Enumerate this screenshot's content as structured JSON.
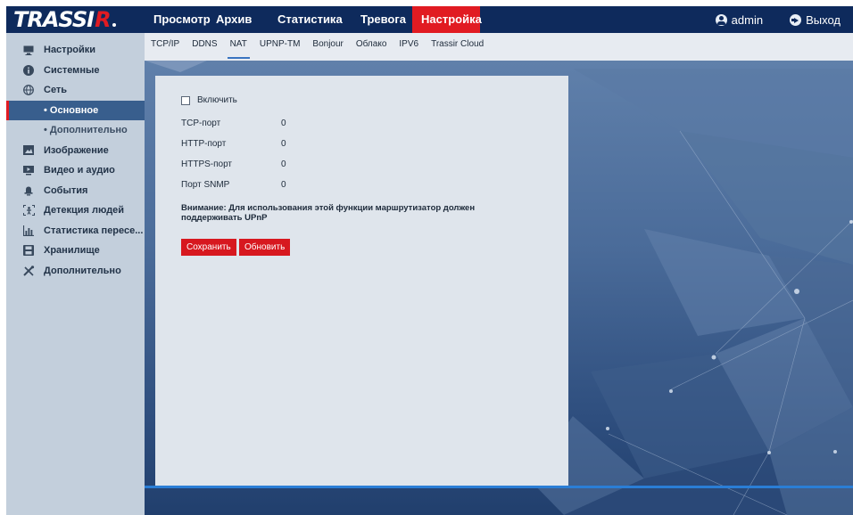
{
  "brand": {
    "logo_main": "TRASSI",
    "logo_accent": "R"
  },
  "top_nav": [
    {
      "label": "Просмотр",
      "active": false
    },
    {
      "label": "Архив",
      "active": false
    },
    {
      "label": "Статистика",
      "active": false
    },
    {
      "label": "Тревога",
      "active": false
    },
    {
      "label": "Настройка",
      "active": true
    }
  ],
  "user": {
    "name": "admin",
    "logout_label": "Выход"
  },
  "sidebar": [
    {
      "label": "Настройки",
      "icon": "monitor-icon",
      "level": 0
    },
    {
      "label": "Системные",
      "icon": "info-icon",
      "level": 0
    },
    {
      "label": "Сеть",
      "icon": "globe-icon",
      "level": 0
    },
    {
      "label": "• Основное",
      "icon": "",
      "level": 1,
      "active": true
    },
    {
      "label": "• Дополнительно",
      "icon": "",
      "level": 1
    },
    {
      "label": "Изображение",
      "icon": "image-icon",
      "level": 0
    },
    {
      "label": "Видео и аудио",
      "icon": "video-icon",
      "level": 0
    },
    {
      "label": "События",
      "icon": "bell-icon",
      "level": 0
    },
    {
      "label": "Детекция людей",
      "icon": "person-detect-icon",
      "level": 0
    },
    {
      "label": "Статистика пересе...",
      "icon": "stats-icon",
      "level": 0
    },
    {
      "label": "Хранилище",
      "icon": "disk-icon",
      "level": 0
    },
    {
      "label": "Дополнительно",
      "icon": "tools-icon",
      "level": 0
    }
  ],
  "subtabs": [
    {
      "label": "TCP/IP",
      "active": false
    },
    {
      "label": "DDNS",
      "active": false
    },
    {
      "label": "NAT",
      "active": true
    },
    {
      "label": "UPNP-TM",
      "active": false
    },
    {
      "label": "Bonjour",
      "active": false
    },
    {
      "label": "Облако",
      "active": false
    },
    {
      "label": "IPV6",
      "active": false
    },
    {
      "label": "Trassir Cloud",
      "active": false
    }
  ],
  "form": {
    "enable_label": "Включить",
    "enable_checked": false,
    "fields": [
      {
        "label": "TCP-порт",
        "value": "0"
      },
      {
        "label": "HTTP-порт",
        "value": "0"
      },
      {
        "label": "HTTPS-порт",
        "value": "0"
      },
      {
        "label": "Порт SNMP",
        "value": "0"
      }
    ],
    "note": "Внимание: Для использования этой функции маршрутизатор должен поддерживать UPnP",
    "save_label": "Сохранить",
    "refresh_label": "Обновить"
  },
  "colors": {
    "topbar": "#0e2a5c",
    "accent_red": "#e11b22",
    "sidebar_bg": "#c3cfdc",
    "sidebar_active": "#385e8d",
    "tab_underline": "#3974c0"
  }
}
